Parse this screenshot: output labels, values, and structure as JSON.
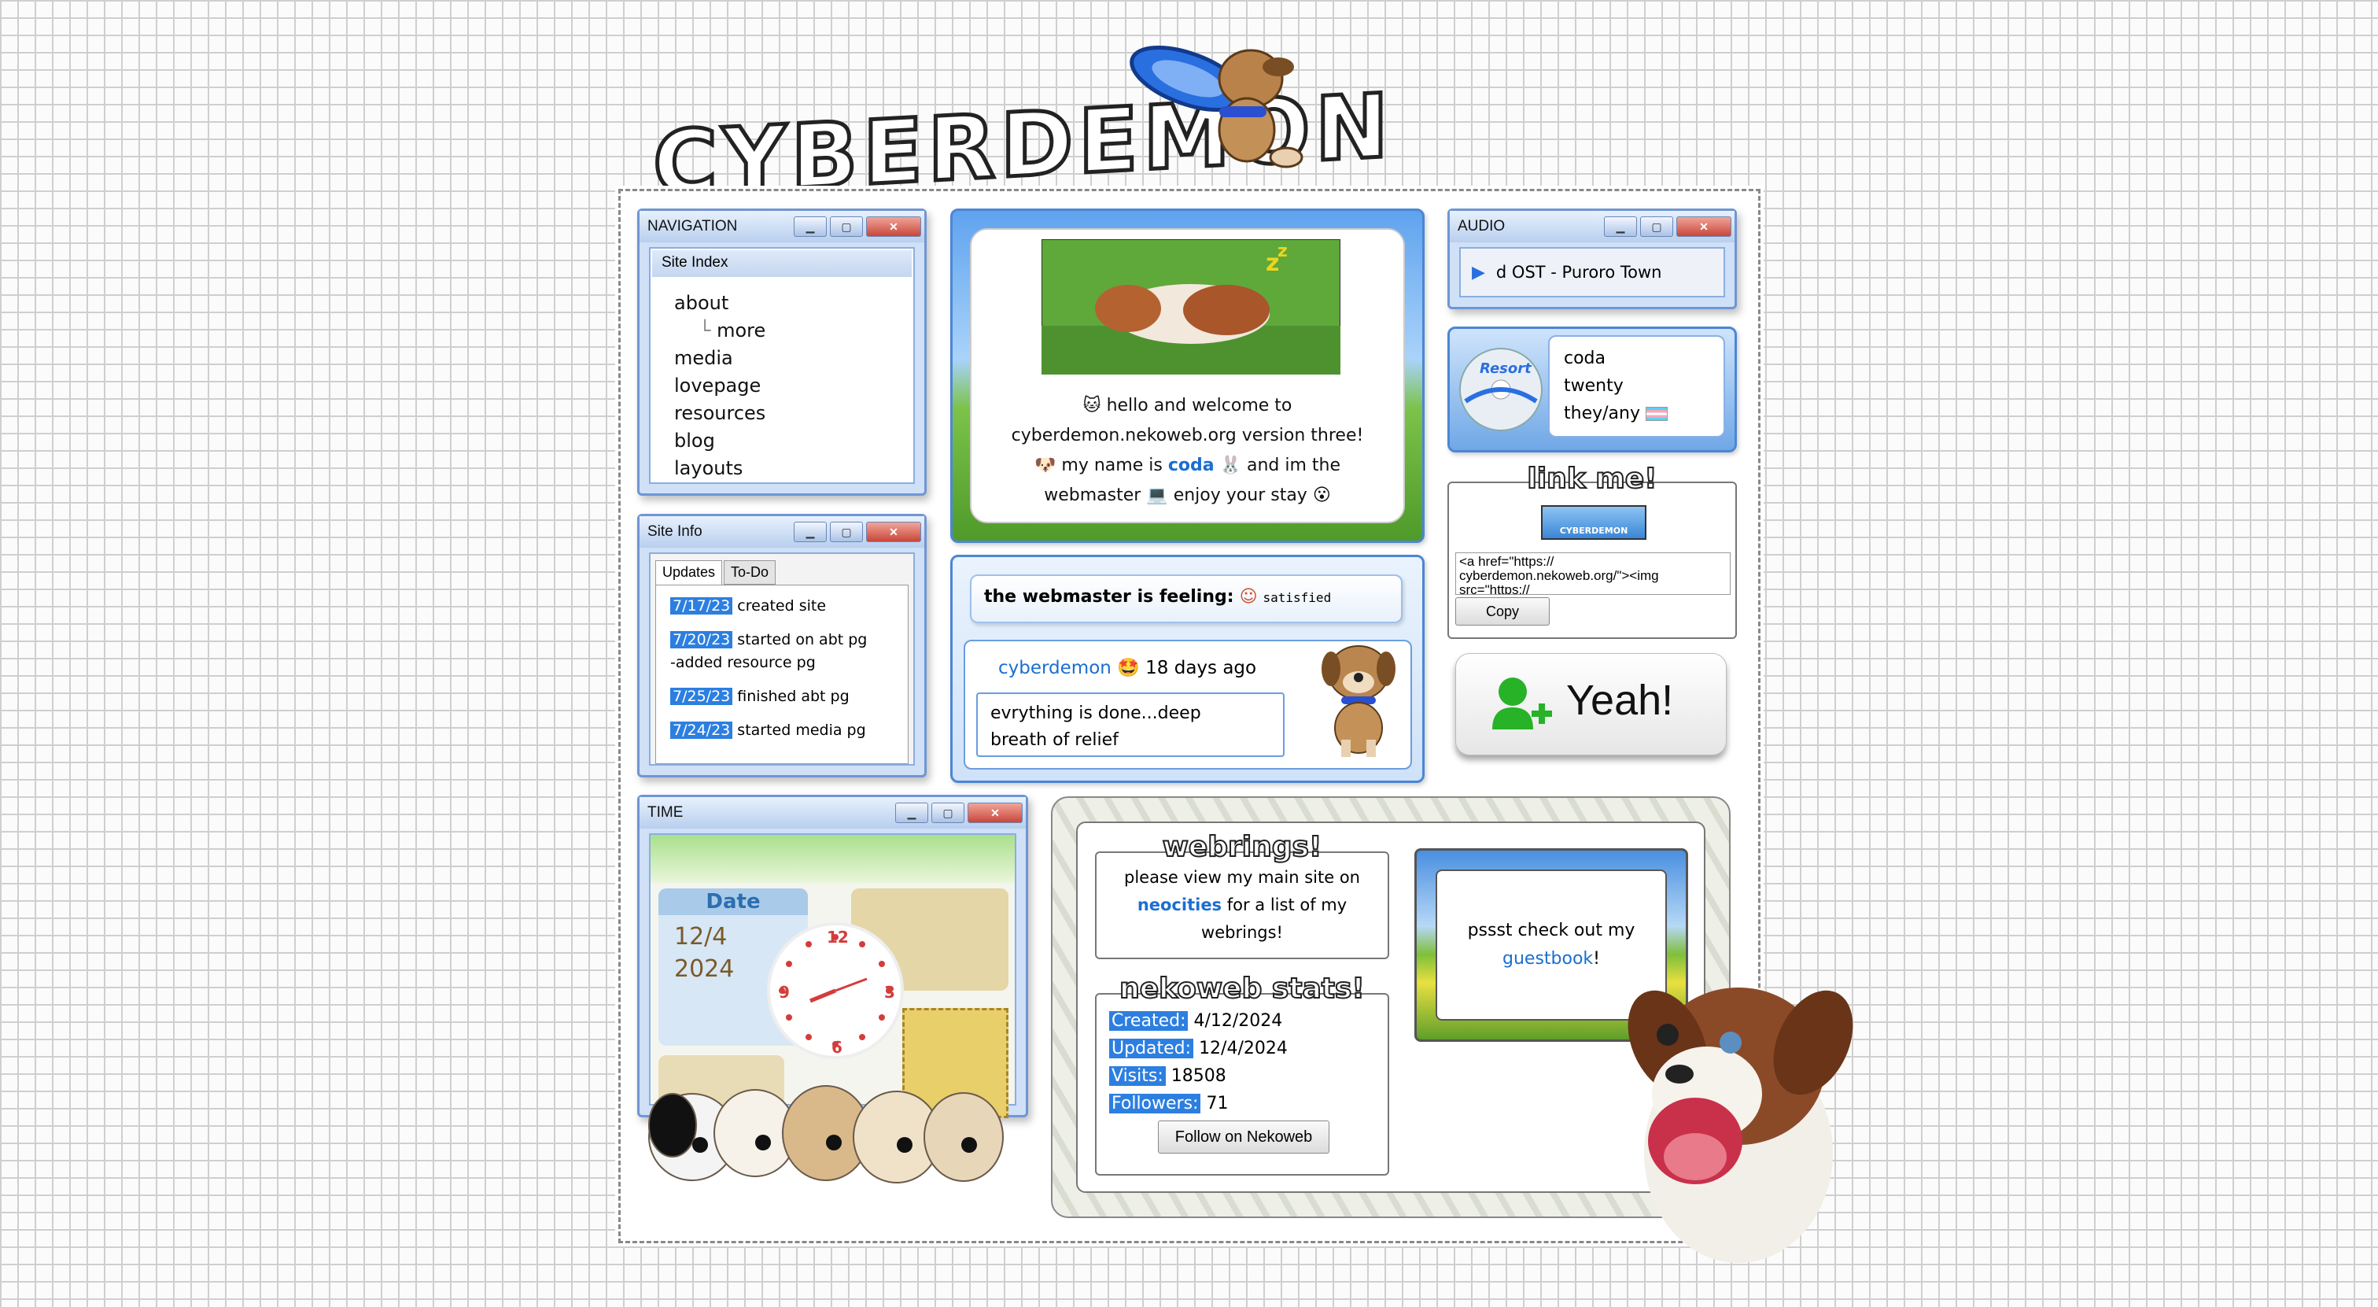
{
  "logo": {
    "text": "CYBERDEMON"
  },
  "navigation": {
    "title": "NAVIGATION",
    "tab": "Site Index",
    "items": [
      "about",
      "more",
      "media",
      "lovepage",
      "resources",
      "blog",
      "layouts"
    ]
  },
  "site_info": {
    "title": "Site Info",
    "tabs": [
      "Updates",
      "To-Do"
    ],
    "updates": [
      {
        "date": "7/17/23",
        "text": "created site"
      },
      {
        "date": "7/20/23",
        "text": "started on abt pg",
        "extra": "-added resource pg"
      },
      {
        "date": "7/25/23",
        "text": "finished abt pg"
      },
      {
        "date": "7/24/23",
        "text": "started media pg"
      }
    ]
  },
  "time": {
    "title": "TIME",
    "date_label": "Date",
    "month_day": "12/4",
    "year": "2024",
    "clock_numbers": [
      "12",
      "3",
      "6",
      "9"
    ]
  },
  "welcome": {
    "line1": "hello and welcome to",
    "line2": "cyberdemon.nekoweb.org version three!",
    "line3a": "my name is",
    "name": "coda",
    "line3b": "and im the",
    "line4": "webmaster",
    "line4b": "enjoy your stay"
  },
  "status": {
    "feeling_label": "the webmaster is feeling:",
    "feeling_value": "satisfied",
    "user": "cyberdemon",
    "age": "18 days ago",
    "message_line1": "evrything is done...deep",
    "message_line2": "breath of relief"
  },
  "audio": {
    "title": "AUDIO",
    "track": "d OST - Puroro Town"
  },
  "profile": {
    "name": "coda",
    "age": "twenty",
    "pronouns": "they/any",
    "disc_label": "Resort"
  },
  "linkme": {
    "heading": "link me!",
    "button_text": "CYBERDEMON",
    "code": "<a href=\"https://\ncyberdemon.nekoweb.org/\"><img\nsrc=\"https://",
    "copy_label": "Copy"
  },
  "yeah": {
    "label": "Yeah!"
  },
  "webrings": {
    "heading": "webrings!",
    "text_a": "please view my main site on",
    "link": "neocities",
    "text_b": "for a list of my",
    "text_c": "webrings!"
  },
  "stats": {
    "heading": "nekoweb stats!",
    "rows": [
      {
        "label": "Created:",
        "value": "4/12/2024"
      },
      {
        "label": "Updated:",
        "value": "12/4/2024"
      },
      {
        "label": "Visits:",
        "value": "18508"
      },
      {
        "label": "Followers:",
        "value": "71"
      }
    ],
    "follow_label": "Follow on Nekoweb"
  },
  "guestbook": {
    "text": "pssst check out my",
    "link": "guestbook",
    "suffix": "!"
  },
  "colors": {
    "accent": "#1a6fd0",
    "window_border": "#6f96d4",
    "highlight": "#2c7fe0"
  }
}
